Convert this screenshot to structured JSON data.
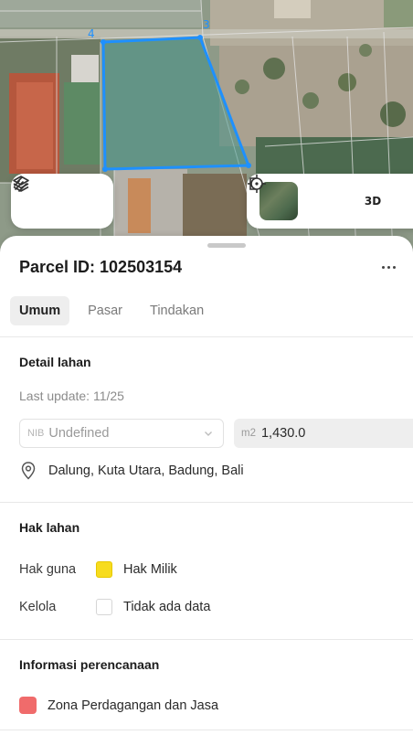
{
  "map": {
    "vertex_labels": [
      "4",
      "3"
    ],
    "parcel_color": "#1e90ff"
  },
  "map_controls": {
    "left": [
      {
        "icon": "layers-icon"
      },
      {
        "icon": "measure-icon"
      }
    ],
    "right": [
      {
        "icon": "satellite-thumbnail"
      },
      {
        "icon": "locate-icon"
      },
      {
        "label": "3D"
      }
    ]
  },
  "parcel": {
    "title": "Parcel ID: 102503154"
  },
  "tabs": [
    {
      "label": "Umum",
      "active": true
    },
    {
      "label": "Pasar",
      "active": false
    },
    {
      "label": "Tindakan",
      "active": false
    }
  ],
  "detail": {
    "heading": "Detail lahan",
    "last_update": "Last update: 11/25",
    "nib_prefix": "NIB",
    "nib_value": "Undefined",
    "area_unit": "m2",
    "area_value": "1,430.0",
    "location": "Dalung, Kuta Utara, Badung, Bali"
  },
  "rights": {
    "heading": "Hak lahan",
    "rows": [
      {
        "label": "Hak guna",
        "value": "Hak Milik",
        "color": "#f7dc1e"
      },
      {
        "label": "Kelola",
        "value": "Tidak ada data",
        "color": ""
      }
    ]
  },
  "planning": {
    "heading": "Informasi perencanaan",
    "zone": "Zona Perdagangan dan Jasa",
    "zone_color": "#f06b6b"
  }
}
